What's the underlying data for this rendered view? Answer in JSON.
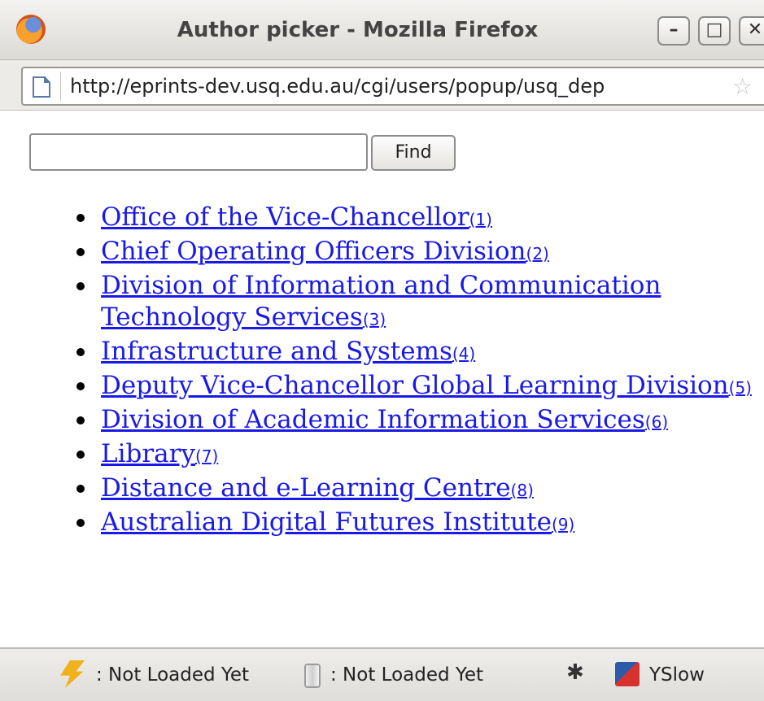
{
  "window": {
    "title": "Author picker - Mozilla Firefox",
    "minimize_label": "–",
    "maximize_label": "□",
    "close_label": "✕"
  },
  "urlbar": {
    "url": "http://eprints-dev.usq.edu.au/cgi/users/popup/usq_dep"
  },
  "search": {
    "value": "",
    "placeholder": "",
    "find_label": "Find"
  },
  "departments": [
    {
      "name": "Office of the Vice-Chancellor",
      "num": "(1)"
    },
    {
      "name": "Chief Operating Officers Division",
      "num": "(2)"
    },
    {
      "name": "Division of Information and Communication Technology Services",
      "num": "(3)"
    },
    {
      "name": "Infrastructure and Systems",
      "num": "(4)"
    },
    {
      "name": "Deputy Vice-Chancellor Global Learning Division",
      "num": "(5)"
    },
    {
      "name": "Division of Academic Information Services",
      "num": "(6)"
    },
    {
      "name": "Library",
      "num": "(7)"
    },
    {
      "name": "Distance and e-Learning Centre",
      "num": "(8)"
    },
    {
      "name": "Australian Digital Futures Institute",
      "num": "(9)"
    }
  ],
  "statusbar": {
    "item1": ": Not Loaded Yet",
    "item2": ": Not Loaded Yet",
    "yslow": "YSlow"
  },
  "colors": {
    "link": "#1a1ae6",
    "accent_bolt": "#f0b21c"
  },
  "icons": [
    "firefox-icon",
    "page-icon",
    "star-icon",
    "lightning-icon",
    "jar-icon",
    "bug-icon",
    "yslow-icon"
  ]
}
